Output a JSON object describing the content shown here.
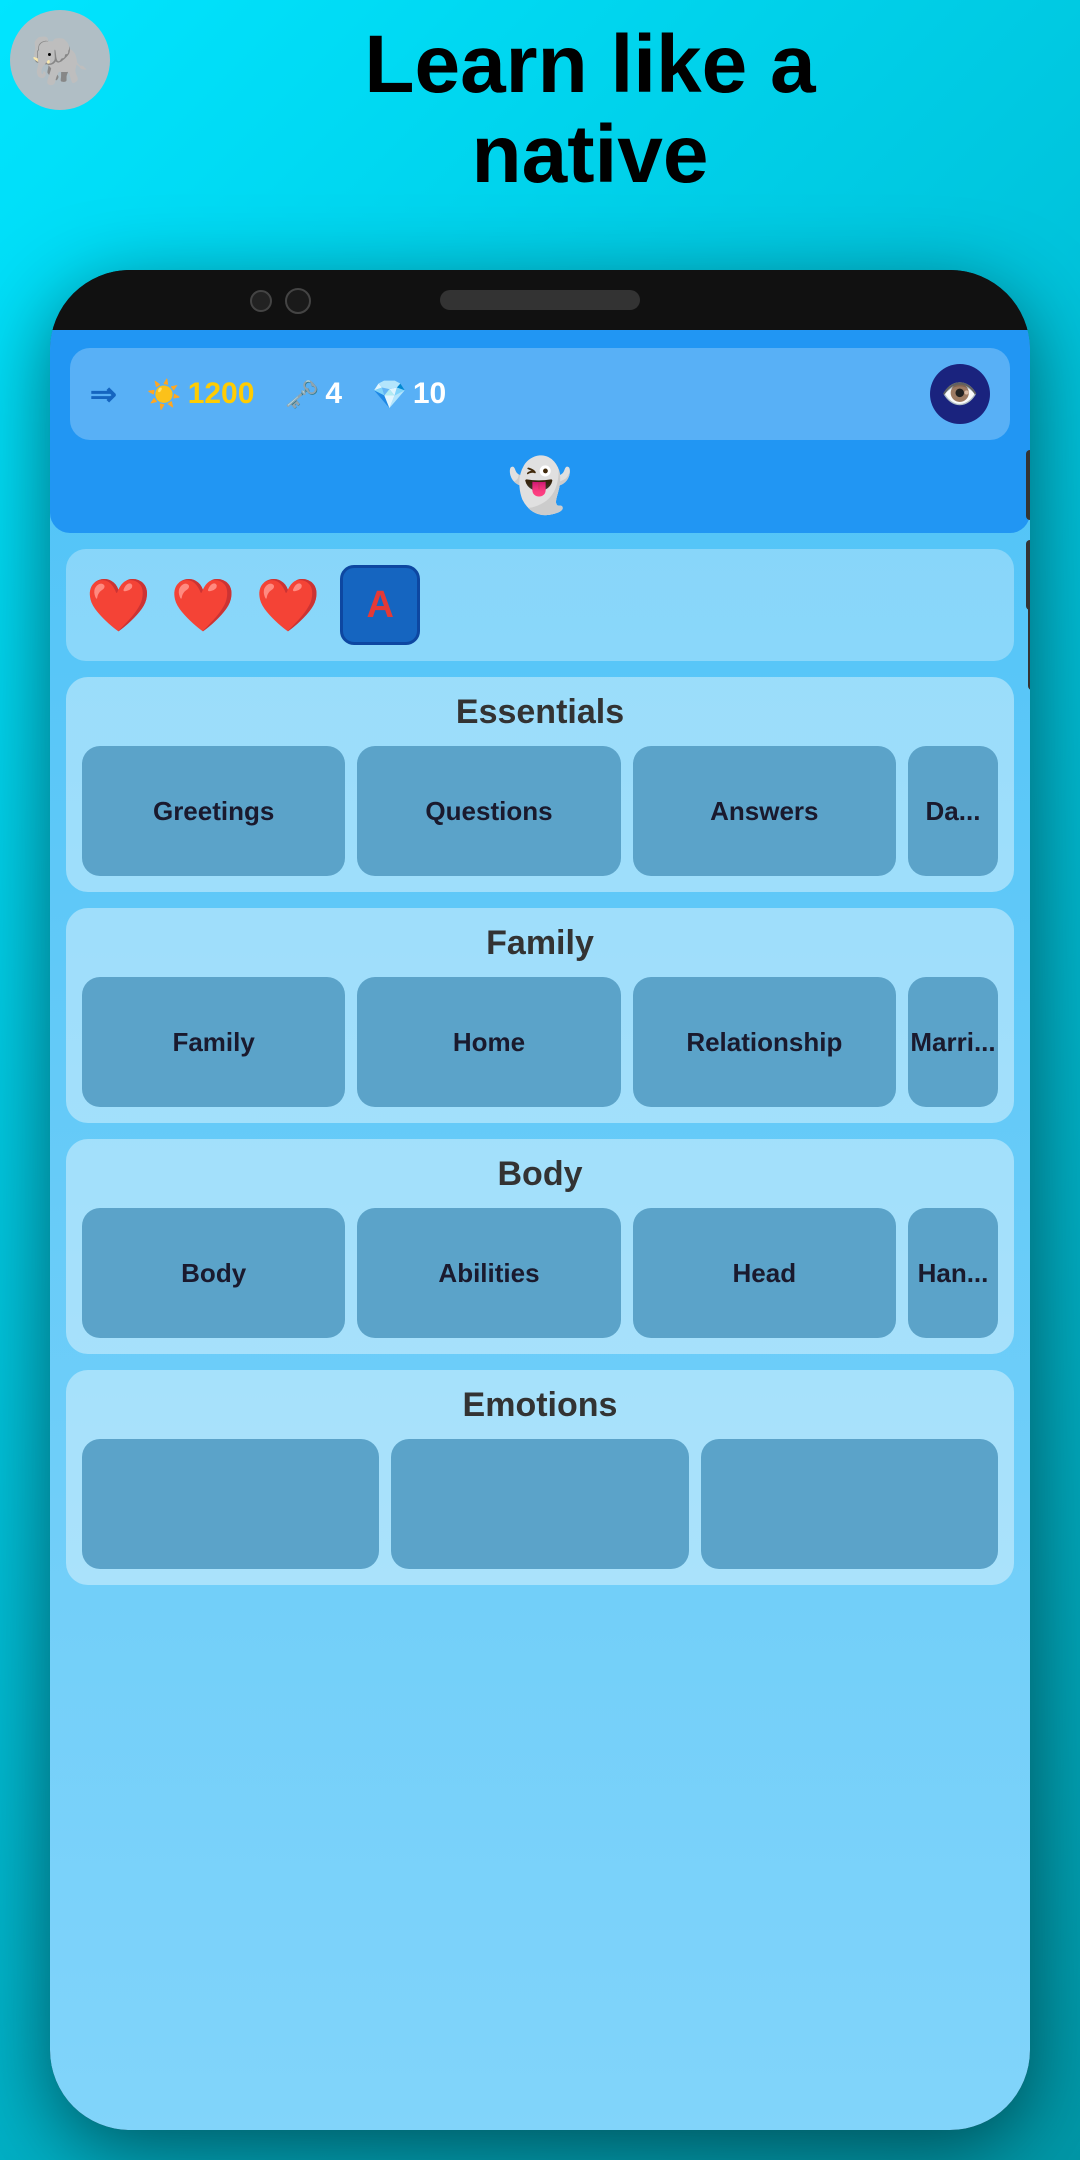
{
  "headline": {
    "line1": "Learn like a",
    "line2": "native"
  },
  "stats": {
    "sun_value": "1200",
    "key_value": "4",
    "gem_value": "10"
  },
  "lives": {
    "hearts": [
      "❤️",
      "❤️",
      "❤️"
    ],
    "letter": "A"
  },
  "sections": [
    {
      "id": "essentials",
      "title": "Essentials",
      "items": [
        "Greetings",
        "Questions",
        "Answers",
        "Da..."
      ]
    },
    {
      "id": "family",
      "title": "Family",
      "items": [
        "Family",
        "Home",
        "Relationship",
        "Marri..."
      ]
    },
    {
      "id": "body",
      "title": "Body",
      "items": [
        "Body",
        "Abilities",
        "Head",
        "Han..."
      ]
    },
    {
      "id": "emotions",
      "title": "Emotions",
      "items": [
        "",
        "",
        ""
      ]
    }
  ]
}
